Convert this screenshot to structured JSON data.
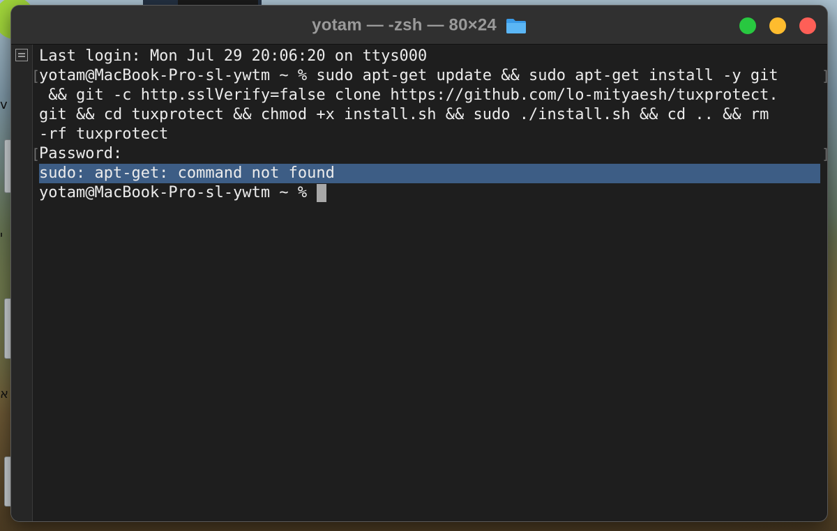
{
  "window": {
    "title": "yotam — -zsh — 80×24",
    "folder_icon": "folder-icon",
    "buttons": [
      "zoom-button",
      "minimize-button",
      "close-button"
    ],
    "colors": {
      "green": "#28c840",
      "yellow": "#febc2e",
      "red": "#fe5f57",
      "selection": "#3d5d85"
    }
  },
  "desktop": {
    "glyph_1": "v",
    "glyph_2": "י",
    "glyph_3": "א"
  },
  "terminal": {
    "line1": "Last login: Mon Jul 29 20:06:20 on ttys000",
    "line2": "yotam@MacBook-Pro-sl-ywtm ~ % sudo apt-get update && sudo apt-get install -y git",
    "line3": " && git -c http.sslVerify=false clone https://github.com/lo-mityaesh/tuxprotect.",
    "line4": "git && cd tuxprotect && chmod +x install.sh && sudo ./install.sh && cd .. && rm",
    "line5": "-rf tuxprotect",
    "line6": "Password:",
    "line7": "sudo: apt-get: command not found",
    "line8": "yotam@MacBook-Pro-sl-ywtm ~ % "
  }
}
